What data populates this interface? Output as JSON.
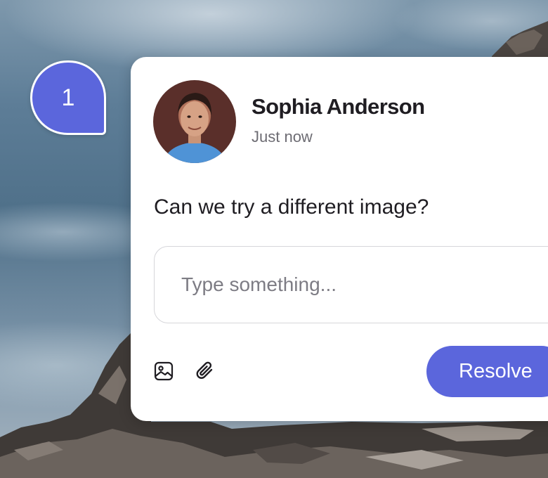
{
  "marker": {
    "number": "1"
  },
  "comment": {
    "author": "Sophia Anderson",
    "timestamp": "Just now",
    "text": "Can we try a different image?"
  },
  "reply": {
    "placeholder": "Type something..."
  },
  "actions": {
    "resolve_label": "Resolve",
    "icons": [
      "image-icon",
      "paperclip-icon"
    ]
  },
  "colors": {
    "accent": "#5b66dc",
    "text": "#1f1d22",
    "muted": "#6d6c73"
  }
}
